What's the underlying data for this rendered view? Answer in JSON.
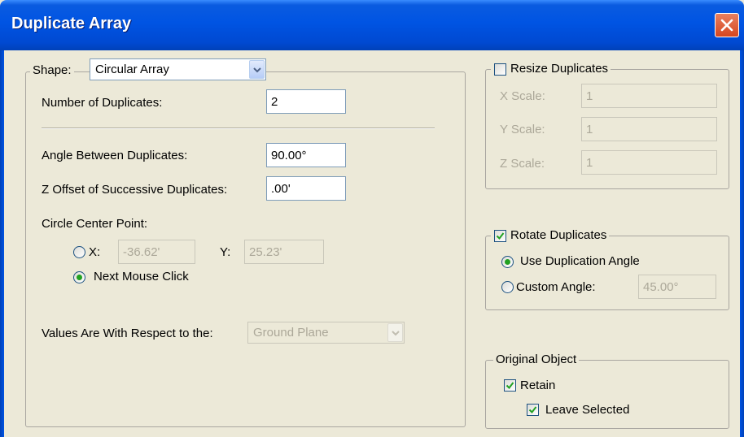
{
  "window": {
    "title": "Duplicate Array"
  },
  "shape": {
    "label": "Shape:",
    "value": "Circular Array",
    "number_label": "Number of Duplicates:",
    "number_value": "2",
    "angle_label": "Angle Between Duplicates:",
    "angle_value": "90.00°",
    "zoffset_label": "Z Offset of Successive Duplicates:",
    "zoffset_value": ".00'",
    "center_label": "Circle Center Point:",
    "x_label": "X:",
    "x_value": "-36.62'",
    "y_label": "Y:",
    "y_value": "25.23'",
    "next_click_label": "Next Mouse Click",
    "respect_label": "Values Are With Respect to the:",
    "respect_value": "Ground Plane",
    "center_mode": "next_mouse_click"
  },
  "resize": {
    "label": "Resize Duplicates",
    "checked": false,
    "x_label": "X Scale:",
    "x_value": "1",
    "y_label": "Y Scale:",
    "y_value": "1",
    "z_label": "Z Scale:",
    "z_value": "1"
  },
  "rotate": {
    "label": "Rotate Duplicates",
    "checked": true,
    "use_angle_label": "Use Duplication Angle",
    "custom_label": "Custom Angle:",
    "custom_value": "45.00°",
    "mode": "use_duplication_angle"
  },
  "original": {
    "label": "Original Object",
    "retain_label": "Retain",
    "retain_checked": true,
    "leave_label": "Leave Selected",
    "leave_checked": true
  },
  "colors": {
    "titlebar": "#0054e3",
    "dialog_bg": "#ece9d8",
    "close_button": "#d5461f",
    "check_mark": "#21a121"
  }
}
